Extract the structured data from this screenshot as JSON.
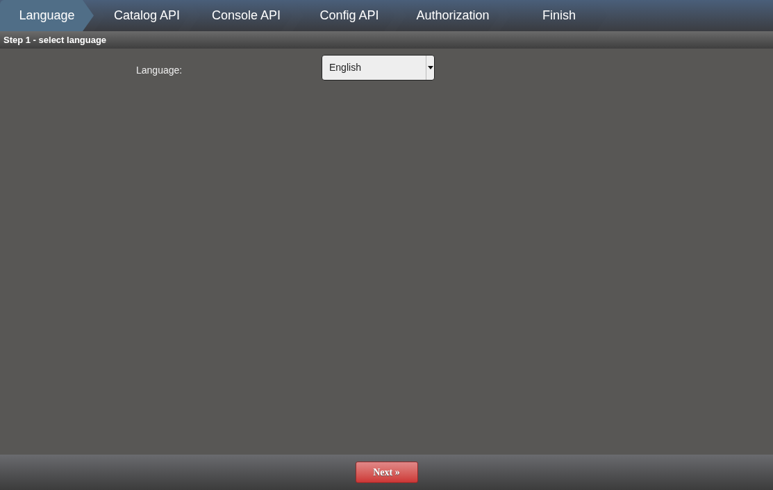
{
  "steps": [
    {
      "label": "Language",
      "selected": true
    },
    {
      "label": "Catalog API",
      "selected": false
    },
    {
      "label": "Console API",
      "selected": false
    },
    {
      "label": "Config API",
      "selected": false
    },
    {
      "label": "Authorization",
      "selected": false
    },
    {
      "label": "Finish",
      "selected": false
    }
  ],
  "step_title": "Step 1 - select language",
  "form": {
    "label": "Language:",
    "value": "English"
  },
  "next_button": "Next »"
}
